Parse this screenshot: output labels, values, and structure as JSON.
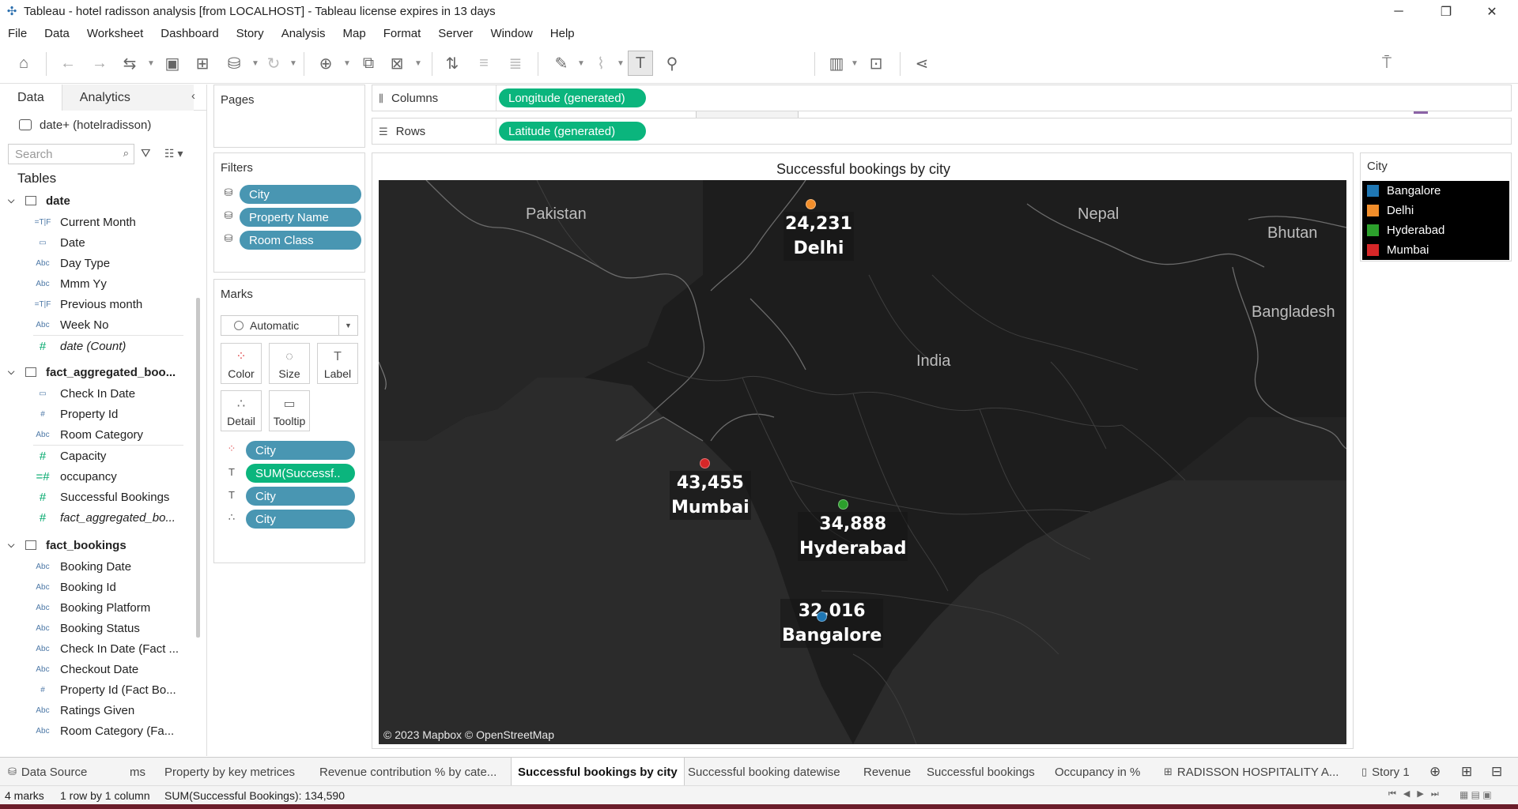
{
  "window": {
    "title": "Tableau - hotel radisson analysis [from LOCALHOST] - Tableau license expires in 13 days",
    "minimize": "─",
    "restore": "❐",
    "close": "✕"
  },
  "menu": [
    "File",
    "Data",
    "Worksheet",
    "Dashboard",
    "Story",
    "Analysis",
    "Map",
    "Format",
    "Server",
    "Window",
    "Help"
  ],
  "toolbar": {
    "show_me": "Show Me"
  },
  "data_pane": {
    "tabs": {
      "data": "Data",
      "analytics": "Analytics"
    },
    "datasource": "date+ (hotelradisson)",
    "search_placeholder": "Search",
    "tables_heading": "Tables",
    "tables": [
      {
        "name": "date",
        "fields": [
          {
            "type": "=T|F",
            "name": "Current Month"
          },
          {
            "type": "cal",
            "name": "Date"
          },
          {
            "type": "Abc",
            "name": "Day Type"
          },
          {
            "type": "Abc",
            "name": "Mmm Yy"
          },
          {
            "type": "=T|F",
            "name": "Previous month"
          },
          {
            "type": "Abc",
            "name": "Week No"
          },
          {
            "type": "#",
            "name": "date (Count)"
          }
        ]
      },
      {
        "name": "fact_aggregated_boo...",
        "fields": [
          {
            "type": "cal",
            "name": "Check In Date"
          },
          {
            "type": "#",
            "name": "Property Id"
          },
          {
            "type": "Abc",
            "name": "Room Category"
          },
          {
            "type": "#",
            "name": "Capacity"
          },
          {
            "type": "=#",
            "name": "occupancy"
          },
          {
            "type": "#",
            "name": "Successful Bookings"
          },
          {
            "type": "#",
            "name": "fact_aggregated_bo..."
          }
        ]
      },
      {
        "name": "fact_bookings",
        "fields": [
          {
            "type": "Abc",
            "name": "Booking Date"
          },
          {
            "type": "Abc",
            "name": "Booking Id"
          },
          {
            "type": "Abc",
            "name": "Booking Platform"
          },
          {
            "type": "Abc",
            "name": "Booking Status"
          },
          {
            "type": "Abc",
            "name": "Check In Date (Fact ..."
          },
          {
            "type": "Abc",
            "name": "Checkout Date"
          },
          {
            "type": "#",
            "name": "Property Id (Fact Bo..."
          },
          {
            "type": "Abc",
            "name": "Ratings Given"
          },
          {
            "type": "Abc",
            "name": "Room Category (Fa..."
          }
        ]
      }
    ]
  },
  "pages": {
    "title": "Pages"
  },
  "filters": {
    "title": "Filters",
    "pills": [
      "City",
      "Property Name",
      "Room Class"
    ]
  },
  "marks": {
    "title": "Marks",
    "type": "Automatic",
    "buttons": [
      "Color",
      "Size",
      "Label",
      "Detail",
      "Tooltip"
    ],
    "pills": [
      "City",
      "SUM(Successf..",
      "City",
      "City"
    ]
  },
  "shelves": {
    "columns_label": "Columns",
    "columns_pill": "Longitude (generated)",
    "rows_label": "Rows",
    "rows_pill": "Latitude (generated)"
  },
  "viz": {
    "title": "Successful bookings by city",
    "countries": [
      "Pakistan",
      "Nepal",
      "Bhutan",
      "Bangladesh",
      "India"
    ],
    "attribution": "© 2023 Mapbox © OpenStreetMap"
  },
  "chart_data": {
    "type": "scatter",
    "title": "Successful bookings by city",
    "measure": "SUM(Successful Bookings)",
    "points": [
      {
        "city": "Delhi",
        "value": 24231,
        "label": "24,231",
        "color": "#f28e2b"
      },
      {
        "city": "Mumbai",
        "value": 43455,
        "label": "43,455",
        "color": "#d62728"
      },
      {
        "city": "Hyderabad",
        "value": 34888,
        "label": "34,888",
        "color": "#2ca02c"
      },
      {
        "city": "Bangalore",
        "value": 32016,
        "label": "32,016",
        "color": "#1f77b4"
      }
    ]
  },
  "legend": {
    "title": "City",
    "items": [
      {
        "name": "Bangalore",
        "color": "#1f77b4"
      },
      {
        "name": "Delhi",
        "color": "#f28e2b"
      },
      {
        "name": "Hyderabad",
        "color": "#2ca02c"
      },
      {
        "name": "Mumbai",
        "color": "#d62728"
      }
    ]
  },
  "sheet_tabs": {
    "data_source": "Data Source",
    "partial": "ms",
    "tabs": [
      "Property by key metrices",
      "Revenue contribution % by cate...",
      "Successful bookings by city",
      "Successful booking datewise",
      "Revenue",
      "Successful bookings",
      "Occupancy in %"
    ],
    "dashboard": "RADISSON HOSPITALITY A...",
    "story": "Story 1"
  },
  "status": {
    "marks": "4 marks",
    "rows": "1 row by 1 column",
    "sum": "SUM(Successful Bookings): 134,590"
  }
}
